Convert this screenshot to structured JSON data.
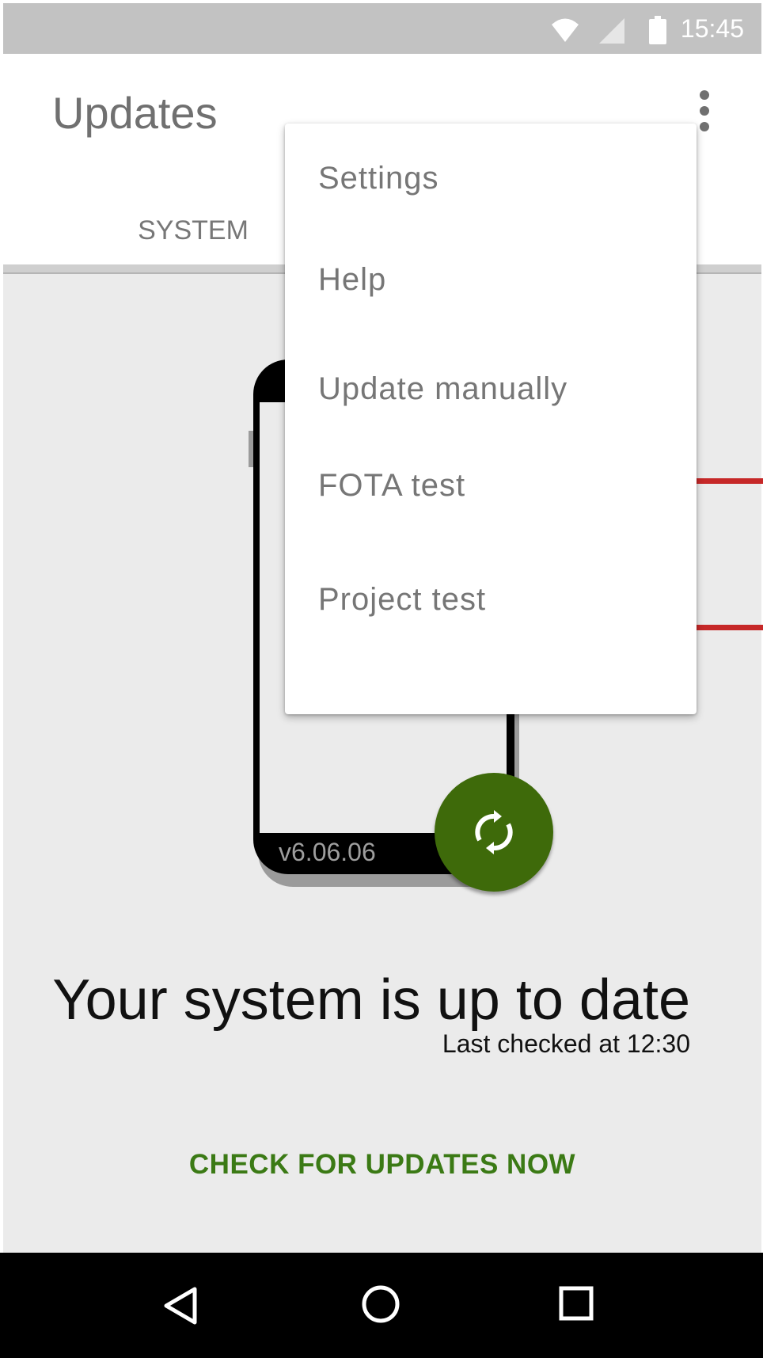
{
  "status_bar": {
    "time": "15:45",
    "icons": [
      "wifi-icon",
      "cell-signal-icon",
      "battery-icon"
    ]
  },
  "app_bar": {
    "title": "Updates",
    "overflow_icon": "more-vert-icon"
  },
  "tabs": [
    {
      "label": "SYSTEM",
      "selected": true
    }
  ],
  "overflow_menu": {
    "items": [
      {
        "label": "Settings"
      },
      {
        "label": "Help"
      },
      {
        "label": "Update manually"
      },
      {
        "label": "FOTA test"
      },
      {
        "label": "Project test"
      }
    ]
  },
  "illustration": {
    "version": "v6.06.06"
  },
  "refresh_fab": {
    "icon": "sync-icon"
  },
  "status": {
    "title": "Your system is up to date",
    "last_checked": "Last checked at 12:30"
  },
  "actions": {
    "check_updates_label": "CHECK FOR UPDATES NOW"
  },
  "nav_bar": {
    "icons": [
      "back-icon",
      "home-icon",
      "recents-icon"
    ]
  },
  "colors": {
    "accent": "#3b7a15",
    "fab": "#3e6a0a",
    "status_bar": "#c2c2c2",
    "content_bg": "#ebebeb",
    "annotation": "#c62828"
  }
}
